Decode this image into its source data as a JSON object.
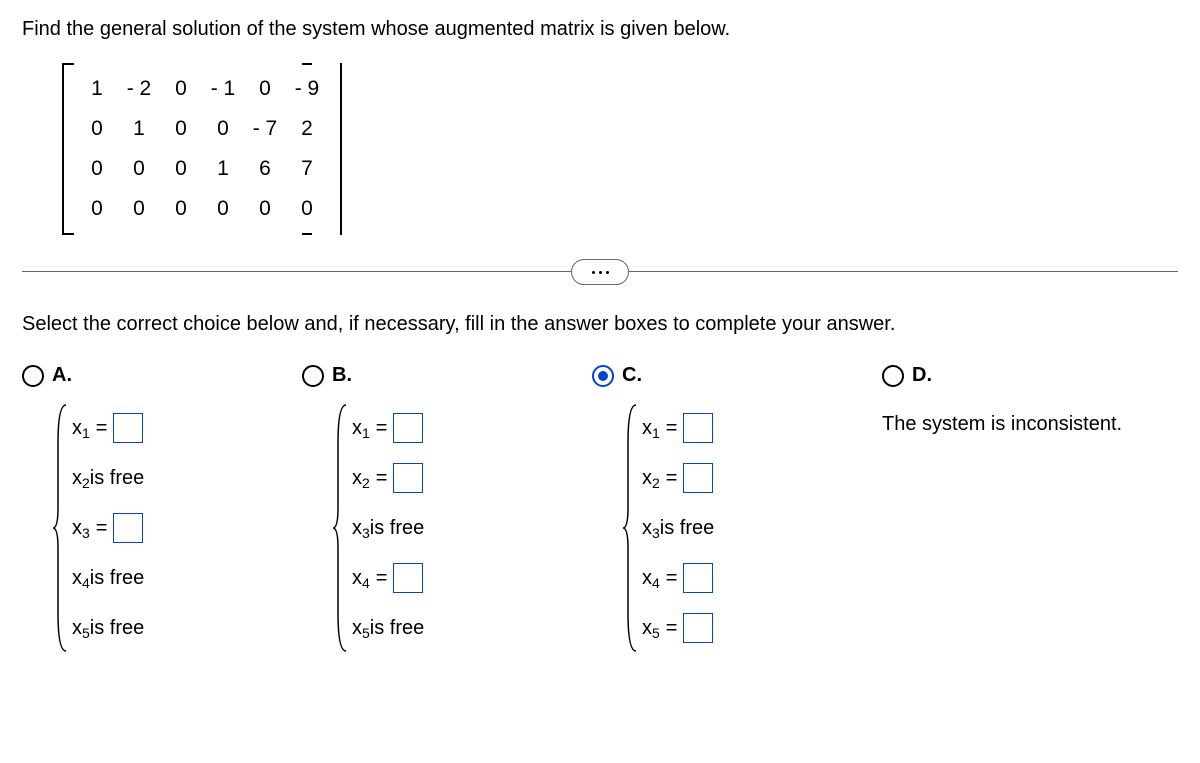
{
  "prompt": "Find the general solution of the system whose augmented matrix is given below.",
  "matrix": {
    "rows": [
      [
        "1",
        "- 2",
        "0",
        "- 1",
        "0",
        "- 9"
      ],
      [
        "0",
        "1",
        "0",
        "0",
        "- 7",
        "2"
      ],
      [
        "0",
        "0",
        "0",
        "1",
        "6",
        "7"
      ],
      [
        "0",
        "0",
        "0",
        "0",
        "0",
        "0"
      ]
    ]
  },
  "instruction": "Select the correct choice below and, if necessary, fill in the answer boxes to complete your answer.",
  "choices": {
    "A": {
      "label": "A.",
      "selected": false,
      "lines": [
        {
          "var": "x",
          "sub": "1",
          "type": "input"
        },
        {
          "var": "x",
          "sub": "2",
          "type": "free",
          "text": " is free"
        },
        {
          "var": "x",
          "sub": "3",
          "type": "input"
        },
        {
          "var": "x",
          "sub": "4",
          "type": "free",
          "text": " is free"
        },
        {
          "var": "x",
          "sub": "5",
          "type": "free",
          "text": " is free"
        }
      ]
    },
    "B": {
      "label": "B.",
      "selected": false,
      "lines": [
        {
          "var": "x",
          "sub": "1",
          "type": "input"
        },
        {
          "var": "x",
          "sub": "2",
          "type": "input"
        },
        {
          "var": "x",
          "sub": "3",
          "type": "free",
          "text": " is free"
        },
        {
          "var": "x",
          "sub": "4",
          "type": "input"
        },
        {
          "var": "x",
          "sub": "5",
          "type": "free",
          "text": " is free"
        }
      ]
    },
    "C": {
      "label": "C.",
      "selected": true,
      "lines": [
        {
          "var": "x",
          "sub": "1",
          "type": "input"
        },
        {
          "var": "x",
          "sub": "2",
          "type": "input"
        },
        {
          "var": "x",
          "sub": "3",
          "type": "free",
          "text": " is free"
        },
        {
          "var": "x",
          "sub": "4",
          "type": "input"
        },
        {
          "var": "x",
          "sub": "5",
          "type": "input"
        }
      ]
    },
    "D": {
      "label": "D.",
      "selected": false,
      "text": "The system is inconsistent."
    }
  }
}
